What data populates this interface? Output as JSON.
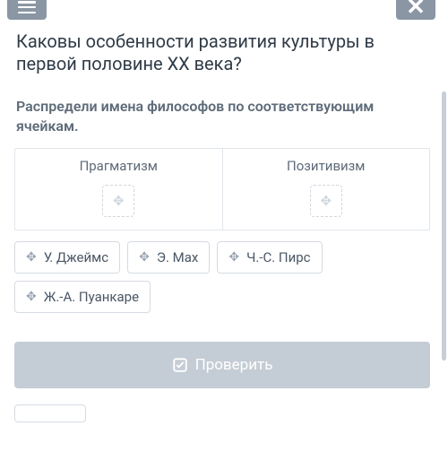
{
  "question": "Каковы особенности развития культуры в первой половине XX века?",
  "instruction": "Распредели имена философов по соответствующим ячейкам.",
  "columns": [
    {
      "label": "Прагматизм"
    },
    {
      "label": "Позитивизм"
    }
  ],
  "chips": [
    {
      "label": "У. Джеймс"
    },
    {
      "label": "Э. Мах"
    },
    {
      "label": "Ч.-С. Пирс"
    },
    {
      "label": "Ж.-А. Пуанкаре"
    }
  ],
  "checkButton": "Проверить"
}
